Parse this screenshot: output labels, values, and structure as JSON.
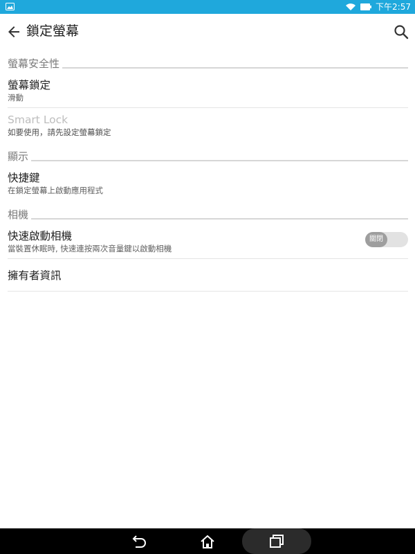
{
  "status_bar": {
    "time": "下午2:57",
    "bg_color": "#1fa8dc",
    "icons": [
      "gallery-notification-icon",
      "wifi-icon",
      "battery-icon"
    ]
  },
  "app_bar": {
    "title": "鎖定螢幕",
    "icons": [
      "back-arrow-icon",
      "search-icon"
    ]
  },
  "sections": [
    {
      "header": "螢幕安全性",
      "items": [
        {
          "title": "螢幕鎖定",
          "summary": "滑動"
        },
        {
          "title": "Smart Lock",
          "summary": "如要使用，請先設定螢幕鎖定",
          "enabled": false
        }
      ]
    },
    {
      "header": "顯示",
      "items": [
        {
          "title": "快捷鍵",
          "summary": "在鎖定螢幕上啟動應用程式"
        }
      ]
    },
    {
      "header": "相機",
      "items": [
        {
          "title": "快速啟動相機",
          "summary": "當裝置休眠時, 快速連按兩次音量鍵以啟動相機",
          "toggle_label": "關閉",
          "toggle_on": false
        },
        {
          "title": "擁有者資訊"
        }
      ]
    }
  ],
  "nav_bar": {
    "icons": [
      "back-nav-icon",
      "home-nav-icon",
      "recent-apps-icon"
    ]
  }
}
